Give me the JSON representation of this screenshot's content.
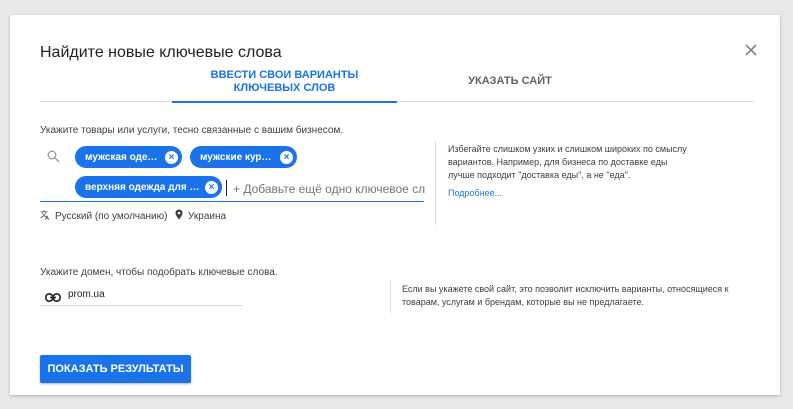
{
  "dialog": {
    "title": "Найдите новые ключевые слова",
    "close_icon": "close-icon"
  },
  "tabs": [
    {
      "label": "Ввести свои варианты ключевых слов",
      "active": true
    },
    {
      "label": "Указать сайт",
      "active": false
    }
  ],
  "keywords_section": {
    "label": "Укажите товары или услуги, тесно связанные с вашим бизнесом.",
    "search_icon": "search-icon",
    "chips": [
      {
        "text": "мужская одежда"
      },
      {
        "text": "мужские куртки"
      },
      {
        "text": "верхняя одежда для му..."
      }
    ],
    "input_placeholder": "+ Добавьте ещё одно ключевое сл",
    "language_icon": "translate-icon",
    "language": "Русский (по умолчанию)",
    "location_icon": "location-pin-icon",
    "location": "Украина",
    "help_text": "Избегайте слишком узких и слишком широких по смыслу вариантов. Например, для бизнеса по доставке еды лучше подходит \"доставка еды\", а не \"еда\".",
    "help_link": "Подробнее..."
  },
  "domain_section": {
    "label": "Укажите домен, чтобы подобрать ключевые слова.",
    "link_icon": "link-icon",
    "value": "prom.ua",
    "help_text": "Если вы укажете свой сайт, это позволит исключить варианты, относящиеся к товарам, услугам и брендам, которые вы не предлагаете."
  },
  "actions": {
    "show_results_label": "Показать результаты"
  },
  "colors": {
    "accent": "#1a73e8",
    "text": "#202124",
    "muted": "#5f6368",
    "divider": "#dadce0"
  }
}
